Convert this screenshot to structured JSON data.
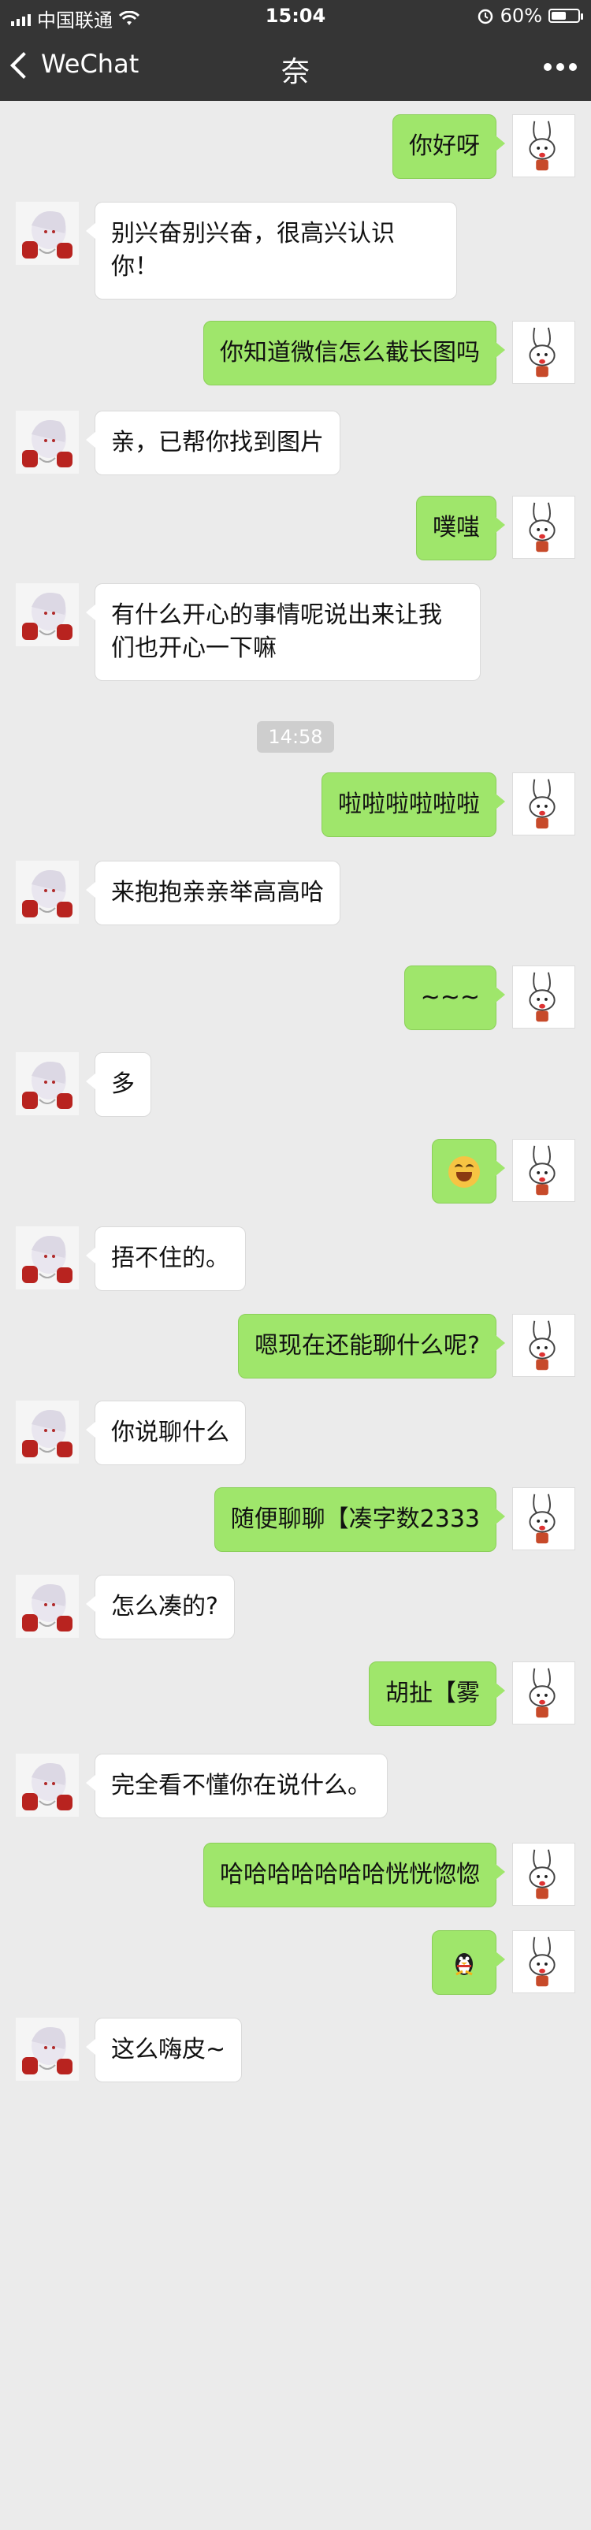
{
  "status_bar": {
    "carrier": "中国联通",
    "time": "15:04",
    "battery": "60%",
    "battery_level": 0.6
  },
  "nav": {
    "back_label": "WeChat",
    "title": "奈"
  },
  "time_divider": "14:58",
  "messages": [
    {
      "side": "right",
      "text": "你好呀"
    },
    {
      "side": "left",
      "text": "别兴奋别兴奋，很高兴认识你！"
    },
    {
      "side": "right",
      "text": "你知道微信怎么截长图吗"
    },
    {
      "side": "left",
      "text": "亲，已帮你找到图片"
    },
    {
      "side": "right",
      "text": "噗嗤"
    },
    {
      "side": "left",
      "text": "有什么开心的事情呢说出来让我们也开心一下嘛"
    },
    {
      "side": "right",
      "text": "啦啦啦啦啦啦"
    },
    {
      "side": "left",
      "text": "来抱抱亲亲举高高哈"
    },
    {
      "side": "right",
      "text": "~~~"
    },
    {
      "side": "left",
      "text": "多"
    },
    {
      "side": "right",
      "text": "",
      "emoji": "laughing-crying-emoji"
    },
    {
      "side": "left",
      "text": "捂不住的。"
    },
    {
      "side": "right",
      "text": "嗯现在还能聊什么呢?"
    },
    {
      "side": "left",
      "text": "你说聊什么"
    },
    {
      "side": "right",
      "text": "随便聊聊【凑字数2333"
    },
    {
      "side": "left",
      "text": "怎么凑的?"
    },
    {
      "side": "right",
      "text": "胡扯【雾"
    },
    {
      "side": "left",
      "text": "完全看不懂你在说什么。"
    },
    {
      "side": "right",
      "text": "哈哈哈哈哈哈哈恍恍惚惚"
    },
    {
      "side": "right",
      "text": "",
      "emoji": "penguin-emoji"
    },
    {
      "side": "left",
      "text": "这么嗨皮~"
    }
  ],
  "colors": {
    "header_bg": "#353535",
    "chat_bg": "#ebebeb",
    "sent_bubble": "#9fe66b",
    "recv_bubble": "#ffffff"
  }
}
